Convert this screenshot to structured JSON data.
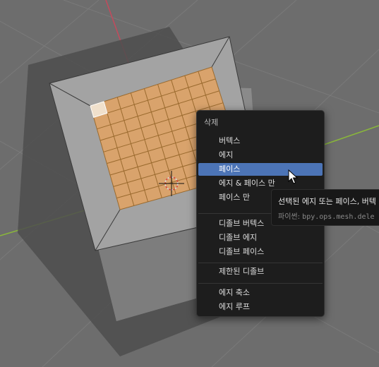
{
  "menu": {
    "title": "삭제",
    "groups": [
      [
        "버텍스",
        "에지",
        "페이스",
        "에지 & 페이스 만",
        "페이스 만"
      ],
      [
        "디졸브 버텍스",
        "디졸브 에지",
        "디졸브 페이스"
      ],
      [
        "제한된 디졸브"
      ],
      [
        "에지 축소",
        "에지 루프"
      ]
    ],
    "active_item": "페이스"
  },
  "tooltip": {
    "description": "선택된 에지 또는 페이스, 버텍",
    "python_label": "파이썬:",
    "python_code": "bpy.ops.mesh.dele"
  },
  "colors": {
    "viewport_bg": "#6d6d6d",
    "selected_face": "#d9a36c",
    "selected_edge": "#9a6a2e",
    "menu_bg": "#1d1d1d",
    "menu_highlight": "#4c74b6",
    "x_axis": "#c44a5c",
    "y_axis": "#8ab83a"
  },
  "icons": [
    "3d-cursor-icon",
    "mouse-pointer-icon"
  ]
}
